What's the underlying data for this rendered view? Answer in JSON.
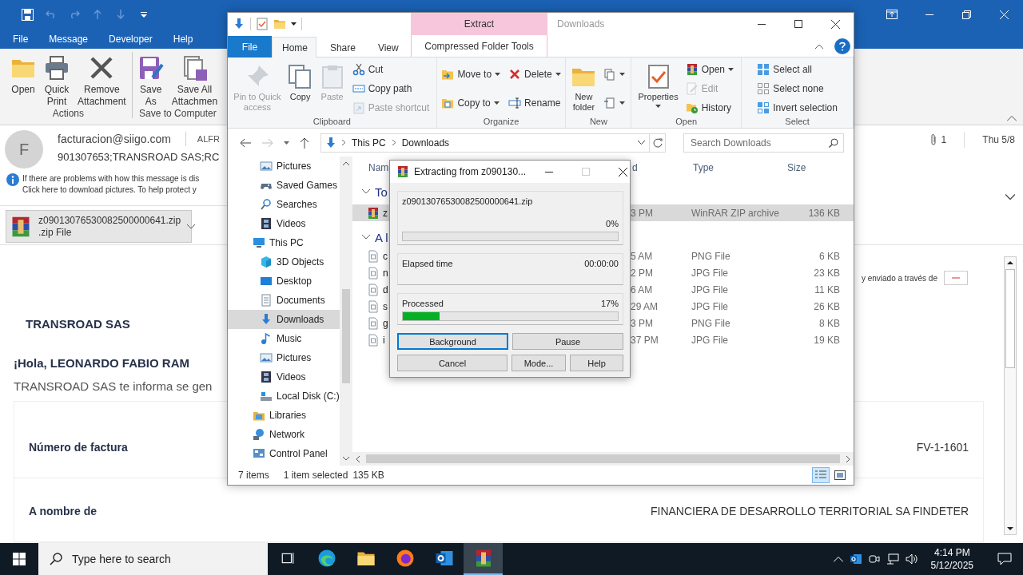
{
  "outlook": {
    "menu": [
      "File",
      "Message",
      "Developer",
      "Help"
    ],
    "ribbon_groups": [
      {
        "label": "Actions",
        "buttons": [
          {
            "kind": "folder",
            "lines": [
              "Open"
            ]
          },
          {
            "kind": "printer",
            "lines": [
              "Quick",
              "Print"
            ]
          },
          {
            "kind": "remove",
            "lines": [
              "Remove",
              "Attachment"
            ]
          }
        ]
      },
      {
        "label": "Save to Computer",
        "buttons": [
          {
            "kind": "saveas",
            "lines": [
              "Save",
              "As"
            ]
          },
          {
            "kind": "saveall",
            "lines": [
              "Save All",
              "Attachmen"
            ]
          }
        ]
      }
    ],
    "message": {
      "avatar": "F",
      "sender": "facturacion@siigo.com",
      "recipient": "ALFR",
      "subject": "901307653;TRANSROAD SAS;RC",
      "info": [
        "If there are problems with how this message is dis",
        "Click here to download pictures. To help protect y"
      ],
      "attachment_count": "1",
      "date": "Thu 5/8",
      "attachment": {
        "name": "z09013076530082500000641.zip",
        "type": ".zip File"
      }
    },
    "body": {
      "sent_via": "y enviado a través de",
      "company": "TRANSROAD SAS",
      "greeting": "¡Hola, LEONARDO FABIO RAM",
      "intro": "TRANSROAD SAS te informa se gen",
      "fields": [
        {
          "label": "Número de factura",
          "value": "FV-1-1601"
        },
        {
          "label": "A nombre de",
          "value": "FINANCIERA DE DESARROLLO TERRITORIAL SA FINDETER"
        }
      ]
    }
  },
  "explorer": {
    "context_label": "Extract",
    "title": "Downloads",
    "tabs": [
      {
        "label": "File",
        "kind": "file",
        "selected": false
      },
      {
        "label": "Home",
        "kind": "tab",
        "selected": true
      },
      {
        "label": "Share",
        "kind": "tab",
        "selected": false
      },
      {
        "label": "View",
        "kind": "tab",
        "selected": false
      }
    ],
    "context_tab": "Compressed Folder Tools",
    "ribbon_groups": [
      {
        "label": "Clipboard",
        "columns": [
          [
            {
              "kind": "pin",
              "lines": [
                "Pin to Quick",
                "access"
              ],
              "large": true,
              "disabled": true,
              "dropdown": false
            }
          ],
          [
            {
              "kind": "copy",
              "lines": [
                "Copy"
              ],
              "large": true,
              "disabled": false,
              "dropdown": false
            }
          ],
          [
            {
              "kind": "paste",
              "lines": [
                "Paste"
              ],
              "large": true,
              "disabled": true,
              "dropdown": false
            }
          ],
          [
            {
              "kind": "cut",
              "lines": [
                "Cut"
              ],
              "large": false,
              "disabled": false,
              "dropdown": false
            },
            {
              "kind": "path",
              "lines": [
                "Copy path"
              ],
              "large": false,
              "disabled": false,
              "dropdown": false
            },
            {
              "kind": "shortcut",
              "lines": [
                "Paste shortcut"
              ],
              "large": false,
              "disabled": true,
              "dropdown": false
            }
          ]
        ]
      },
      {
        "label": "Organize",
        "columns": [
          [
            {
              "kind": "move",
              "lines": [
                "Move to"
              ],
              "large": false,
              "disabled": false,
              "dropdown": true
            },
            {
              "kind": "copyto",
              "lines": [
                "Copy to"
              ],
              "large": false,
              "disabled": false,
              "dropdown": true
            }
          ],
          [
            {
              "kind": "delete",
              "lines": [
                "Delete"
              ],
              "large": false,
              "disabled": false,
              "dropdown": true
            },
            {
              "kind": "rename",
              "lines": [
                "Rename"
              ],
              "large": false,
              "disabled": false,
              "dropdown": false
            }
          ]
        ]
      },
      {
        "label": "New",
        "columns": [
          [
            {
              "kind": "newfolder",
              "lines": [
                "New",
                "folder"
              ],
              "large": true,
              "disabled": false,
              "dropdown": false
            }
          ],
          [
            {
              "kind": "newitem",
              "large": false,
              "disabled": false,
              "dropdown": true
            },
            {
              "kind": "easy",
              "large": false,
              "disabled": false,
              "dropdown": true
            }
          ]
        ]
      },
      {
        "label": "Open",
        "columns": [
          [
            {
              "kind": "properties",
              "lines": [
                "Properties"
              ],
              "large": true,
              "disabled": false,
              "dropdown": true
            }
          ],
          [
            {
              "kind": "archive",
              "lines": [
                "Open"
              ],
              "large": false,
              "disabled": false,
              "dropdown": true
            },
            {
              "kind": "edit",
              "lines": [
                "Edit"
              ],
              "large": false,
              "disabled": true,
              "dropdown": false
            },
            {
              "kind": "history",
              "lines": [
                "History"
              ],
              "large": false,
              "disabled": false,
              "dropdown": false
            }
          ]
        ]
      },
      {
        "label": "Select",
        "columns": [
          [
            {
              "kind": "selectall",
              "lines": [
                "Select all"
              ],
              "large": false,
              "disabled": false,
              "dropdown": false
            },
            {
              "kind": "selectnone",
              "lines": [
                "Select none"
              ],
              "large": false,
              "disabled": false,
              "dropdown": false
            },
            {
              "kind": "invert",
              "lines": [
                "Invert selection"
              ],
              "large": false,
              "disabled": false,
              "dropdown": false
            }
          ]
        ]
      }
    ],
    "path": [
      "This PC",
      "Downloads"
    ],
    "search_placeholder": "Search Downloads",
    "nav_continued": [
      {
        "label": "Pictures",
        "kind": "pictures",
        "selected": false
      },
      {
        "label": "Saved Games",
        "kind": "games",
        "selected": false
      },
      {
        "label": "Searches",
        "kind": "search",
        "selected": false
      },
      {
        "label": "Videos",
        "kind": "video",
        "selected": false
      }
    ],
    "nav": [
      {
        "label": "This PC",
        "kind": "pc",
        "selected": false,
        "children": [
          {
            "label": "3D Objects",
            "kind": "cube",
            "selected": false
          },
          {
            "label": "Desktop",
            "kind": "desktop",
            "selected": false
          },
          {
            "label": "Documents",
            "kind": "documents",
            "selected": false
          },
          {
            "label": "Downloads",
            "kind": "download",
            "selected": true
          },
          {
            "label": "Music",
            "kind": "music",
            "selected": false
          },
          {
            "label": "Pictures",
            "kind": "pictures",
            "selected": false
          },
          {
            "label": "Videos",
            "kind": "video",
            "selected": false
          },
          {
            "label": "Local Disk (C:)",
            "kind": "disk",
            "selected": false
          }
        ]
      },
      {
        "label": "Libraries",
        "kind": "libraries",
        "selected": false
      },
      {
        "label": "Network",
        "kind": "network",
        "selected": false
      },
      {
        "label": "Control Panel",
        "kind": "control",
        "selected": false
      }
    ],
    "columns": [
      "Nam",
      "d",
      "Type",
      "Size"
    ],
    "groups": [
      {
        "label": "To",
        "files": [
          {
            "name": "z",
            "date": "3 PM",
            "type": "WinRAR ZIP archive",
            "size": "136 KB",
            "kind": "archive",
            "selected": true
          }
        ]
      },
      {
        "label": "A l",
        "files": [
          {
            "name": "c",
            "date": "5 AM",
            "type": "PNG File",
            "size": "6 KB",
            "kind": "file",
            "selected": false
          },
          {
            "name": "n",
            "date": "2 PM",
            "type": "JPG File",
            "size": "23 KB",
            "kind": "file",
            "selected": false
          },
          {
            "name": "d",
            "date": "6 AM",
            "type": "JPG File",
            "size": "11 KB",
            "kind": "file",
            "selected": false
          },
          {
            "name": "s",
            "date": "29 AM",
            "type": "JPG File",
            "size": "26 KB",
            "kind": "file",
            "selected": false
          },
          {
            "name": "g",
            "date": "3 PM",
            "type": "PNG File",
            "size": "8 KB",
            "kind": "file",
            "selected": false
          },
          {
            "name": "i",
            "date": "37 PM",
            "type": "JPG File",
            "size": "19 KB",
            "kind": "file",
            "selected": false
          }
        ]
      }
    ],
    "status": {
      "count": "7 items",
      "selection": "1 item selected",
      "size": "135 KB"
    }
  },
  "dialog": {
    "title": "Extracting from z090130...",
    "file": "z09013076530082500000641.zip",
    "file_progress": {
      "percent": "0%",
      "level": 0
    },
    "elapsed_label": "Elapsed time",
    "elapsed": "00:00:00",
    "processed": {
      "label": "Processed",
      "percent": "17%",
      "level": 0.17
    },
    "buttons": [
      {
        "label": "Background",
        "selected": true
      },
      {
        "label": "Pause",
        "selected": false
      },
      {
        "label": "Cancel",
        "selected": false
      },
      {
        "label": "Mode...",
        "selected": false
      },
      {
        "label": "Help",
        "selected": false
      }
    ]
  },
  "taskbar": {
    "search_placeholder": "Type here to search",
    "apps": [
      {
        "kind": "taskview",
        "selected": false
      },
      {
        "kind": "edge",
        "selected": false
      },
      {
        "kind": "explorer",
        "selected": false
      },
      {
        "kind": "firefox",
        "selected": false
      },
      {
        "kind": "outlook",
        "selected": false
      },
      {
        "kind": "winrar",
        "selected": true
      }
    ],
    "time": "4:14 PM",
    "date": "5/12/2025"
  }
}
